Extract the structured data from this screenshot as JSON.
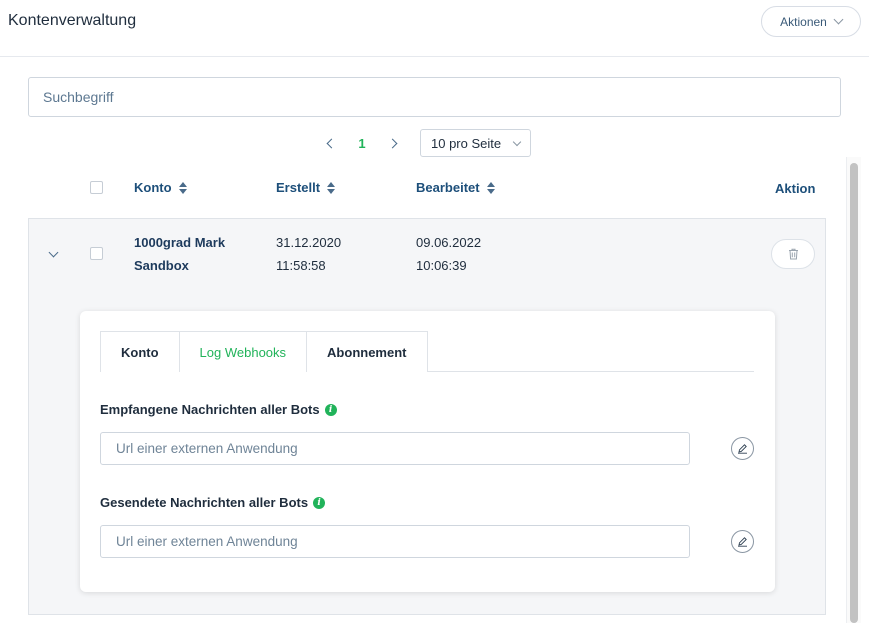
{
  "header": {
    "title": "Kontenverwaltung",
    "actions_label": "Aktionen"
  },
  "search": {
    "placeholder": "Suchbegriff",
    "value": ""
  },
  "pagination": {
    "current_page": "1",
    "per_page": "10 pro Seite"
  },
  "table": {
    "columns": {
      "konto": "Konto",
      "erstellt": "Erstellt",
      "bearbeitet": "Bearbeitet",
      "aktion": "Aktion"
    },
    "rows": [
      {
        "konto_line1": "1000grad Mark",
        "konto_line2": "Sandbox",
        "erstellt_date": "31.12.2020",
        "erstellt_time": "11:58:58",
        "bearbeitet_date": "09.06.2022",
        "bearbeitet_time": "10:06:39"
      }
    ]
  },
  "detail": {
    "tabs": [
      {
        "label": "Konto",
        "active": false
      },
      {
        "label": "Log Webhooks",
        "active": true
      },
      {
        "label": "Abonnement",
        "active": false
      }
    ],
    "received": {
      "label": "Empfangene Nachrichten aller Bots",
      "placeholder": "Url einer externen Anwendung",
      "value": ""
    },
    "sent": {
      "label": "Gesendete Nachrichten aller Bots",
      "placeholder": "Url einer externen Anwendung",
      "value": ""
    },
    "info_glyph": "i"
  },
  "colors": {
    "accent": "#21b35a",
    "header_text": "#1d4f7a",
    "row_bg": "#f5f6f8"
  },
  "icons": {
    "actions": "chevron-down-icon",
    "prev": "chevron-left-icon",
    "next": "chevron-right-icon",
    "sort": "sort-icon",
    "expand": "chevron-down-icon",
    "delete": "trash-icon",
    "info": "info-icon",
    "edit": "pencil-icon"
  }
}
